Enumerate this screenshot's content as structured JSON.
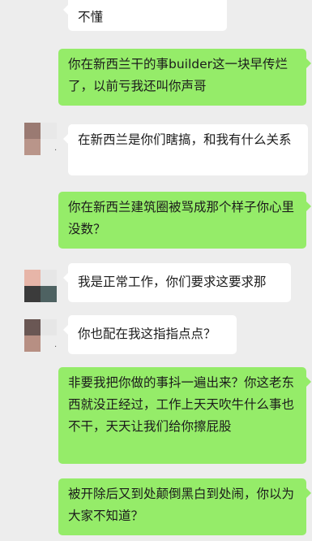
{
  "messages": [
    {
      "side": "in",
      "text": "不懂"
    },
    {
      "side": "out",
      "text": "你在新西兰干的事builder这一块早传烂了，以前亏我还叫你声哥"
    },
    {
      "side": "in",
      "text": "在新西兰是你们瞎搞，和我有什么关系"
    },
    {
      "side": "out",
      "text": "你在新西兰建筑圈被骂成那个样子你心里没数？"
    },
    {
      "side": "in",
      "text": "我是正常工作，你们要求这要求那"
    },
    {
      "side": "in",
      "text": "你也配在我这指指点点？"
    },
    {
      "side": "out",
      "text": "非要我把你做的事抖一遍出来？你这老东西就没正经过，工作上天天吹牛什么事也不干，天天让我们给你擦屁股"
    },
    {
      "side": "out",
      "text": "被开除后又到处颠倒黑白到处闹，你以为大家不知道？"
    }
  ],
  "colors": {
    "background": "#ededed",
    "incoming_bubble": "#ffffff",
    "outgoing_bubble": "#95ec69"
  }
}
